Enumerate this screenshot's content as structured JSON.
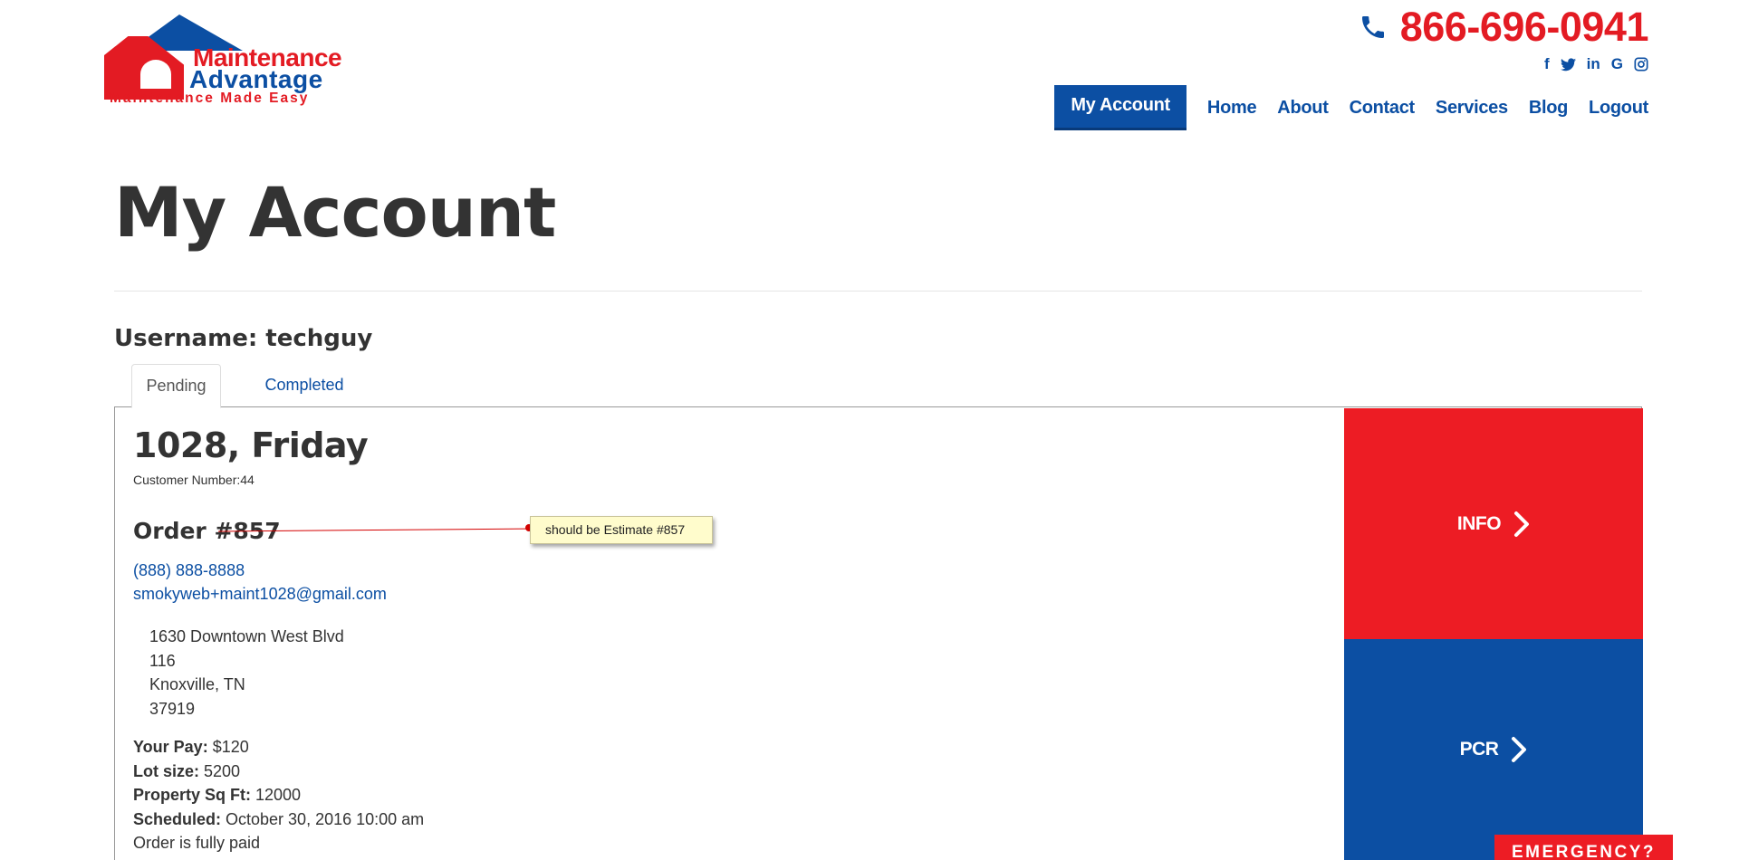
{
  "header": {
    "logo": {
      "line1": "Maintenance",
      "line2": "Advantage",
      "tagline": "Maintenance Made Easy"
    },
    "phone": "866-696-0941",
    "social_icons": [
      "facebook-icon",
      "twitter-icon",
      "linkedin-icon",
      "google-icon",
      "instagram-icon"
    ],
    "nav": {
      "active": "My Account",
      "items": [
        "Home",
        "About",
        "Contact",
        "Services",
        "Blog",
        "Logout"
      ]
    }
  },
  "page": {
    "title": "My Account",
    "username_label": "Username: techguy"
  },
  "tabs": {
    "pending": "Pending",
    "completed": "Completed"
  },
  "order": {
    "title": "1028, Friday",
    "customer_number": "Customer Number:44",
    "order_number": "Order #857",
    "annotation": "should be Estimate #857",
    "phone": "(888) 888-8888",
    "email": "smokyweb+maint1028@gmail.com",
    "address": [
      "1630 Downtown West Blvd",
      "116",
      "Knoxville, TN",
      "37919"
    ],
    "details": {
      "pay_label": "Your Pay:",
      "pay_value": " $120",
      "lot_label": "Lot size:",
      "lot_value": " 5200",
      "sqft_label": "Property Sq Ft:",
      "sqft_value": " 12000",
      "scheduled_label": "Scheduled:",
      "scheduled_value": " October 30, 2016 10:00 am",
      "status": "Order is fully paid"
    },
    "actions": {
      "info": "INFO",
      "pcr": "PCR"
    }
  },
  "emergency": "EMERGENCY?",
  "colors": {
    "brand_red": "#ed1c24",
    "brand_blue": "#0c4fa3"
  }
}
